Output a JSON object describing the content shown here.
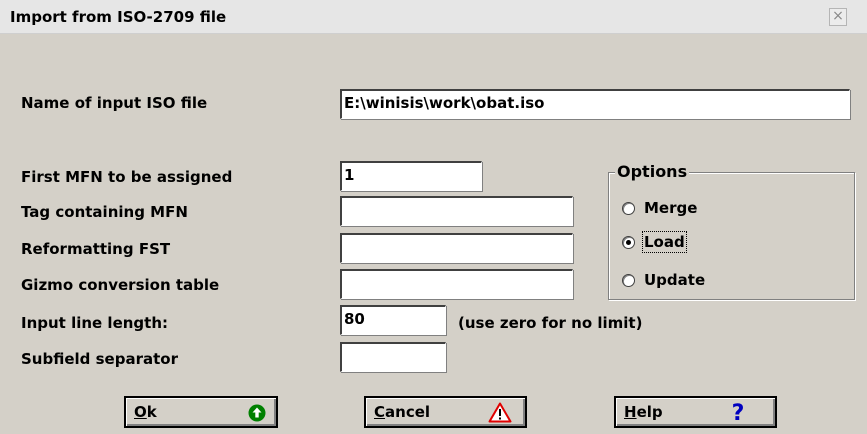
{
  "window": {
    "title": "Import from ISO-2709 file",
    "close_glyph": "×"
  },
  "form": {
    "input_file_label": "Name of input ISO file",
    "input_file_value": "E:\\winisis\\work\\obat.iso",
    "first_mfn_label": "First MFN to be assigned",
    "first_mfn_value": "1",
    "tag_mfn_label": "Tag containing MFN",
    "tag_mfn_value": "",
    "reformat_fst_label": "Reformatting FST",
    "reformat_fst_value": "",
    "gizmo_label": "Gizmo conversion table",
    "gizmo_value": "",
    "line_length_label": "Input line length:",
    "line_length_value": "80",
    "line_length_hint": "(use zero for no limit)",
    "subfield_label": "Subfield separator",
    "subfield_value": ""
  },
  "options": {
    "title": "Options",
    "selected": "Load",
    "items": [
      {
        "label": "Merge",
        "checked": false
      },
      {
        "label": "Load",
        "checked": true
      },
      {
        "label": "Update",
        "checked": false
      }
    ]
  },
  "buttons": {
    "ok_label": "Ok",
    "ok_icon": "green-circle-up-arrow-icon",
    "cancel_label": "Cancel",
    "cancel_icon": "warning-triangle-icon",
    "help_label": "Help",
    "help_icon": "question-mark-icon"
  },
  "colors": {
    "dialog_bg": "#d4d0c8",
    "ok_icon_green": "#008000",
    "warning_red": "#e00000",
    "help_blue": "#0000c0"
  }
}
